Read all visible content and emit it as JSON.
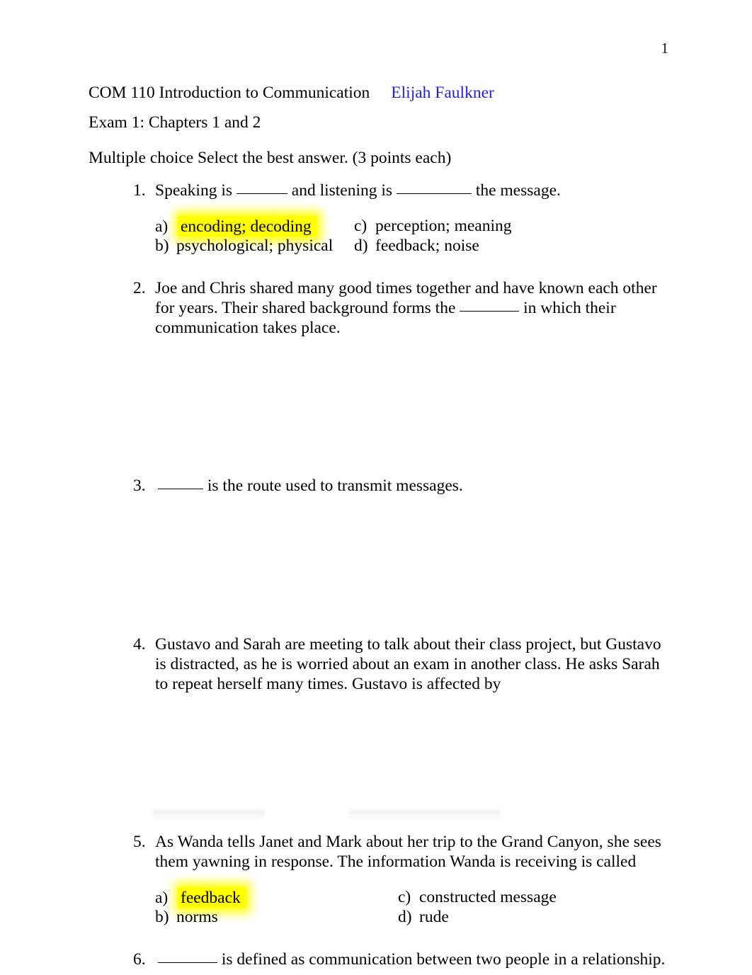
{
  "document": {
    "page_number": "1",
    "course": "COM 110 Introduction to Communication",
    "student_name": "Elijah Faulkner",
    "exam_title": "Exam 1: Chapters 1 and 2",
    "instructions": "Multiple choice Select the best answer. (3 points each)",
    "name_color": "#2222dd",
    "highlight_color": "#ffff00"
  },
  "questions": [
    {
      "number": "1.",
      "text_parts": {
        "part1": "Speaking is ",
        "part2": " and listening is ",
        "part3": " the message."
      },
      "options": {
        "a_letter": "a)",
        "a_text": "encoding; decoding",
        "b_letter": "b)",
        "b_text": "psychological; physical",
        "c_letter": "c)",
        "c_text": "perception; meaning",
        "d_letter": "d)",
        "d_text": "feedback; noise"
      },
      "highlighted_answer": "a"
    },
    {
      "number": "2.",
      "text_parts": {
        "part1": "Joe and Chris shared many good times together and have known each other for years. Their shared background forms the ",
        "part2": " in which their communication takes place."
      },
      "options": null
    },
    {
      "number": "3.",
      "text_parts": {
        "part1": "",
        "part2": " is the route used to transmit messages."
      },
      "options": null
    },
    {
      "number": "4.",
      "text_parts": {
        "part1": "Gustavo and Sarah are meeting to talk about their class project, but Gustavo is distracted, as he is worried about an exam in another class. He asks Sarah to repeat herself many times. Gustavo is affected by"
      },
      "options": null
    },
    {
      "number": "5.",
      "text_parts": {
        "part1": "As Wanda tells Janet and Mark about her trip to the Grand Canyon, she sees them yawning in response. The information Wanda is receiving is called"
      },
      "options": {
        "a_letter": "a)",
        "a_text": "feedback",
        "b_letter": "b)",
        "b_text": "norms",
        "c_letter": "c)",
        "c_text": "constructed message",
        "d_letter": "d)",
        "d_text": "rude"
      },
      "highlighted_answer": "a"
    },
    {
      "number": "6.",
      "text_parts": {
        "part1": "",
        "part2": " is defined as communication between two people in a relationship."
      },
      "options": null
    }
  ]
}
